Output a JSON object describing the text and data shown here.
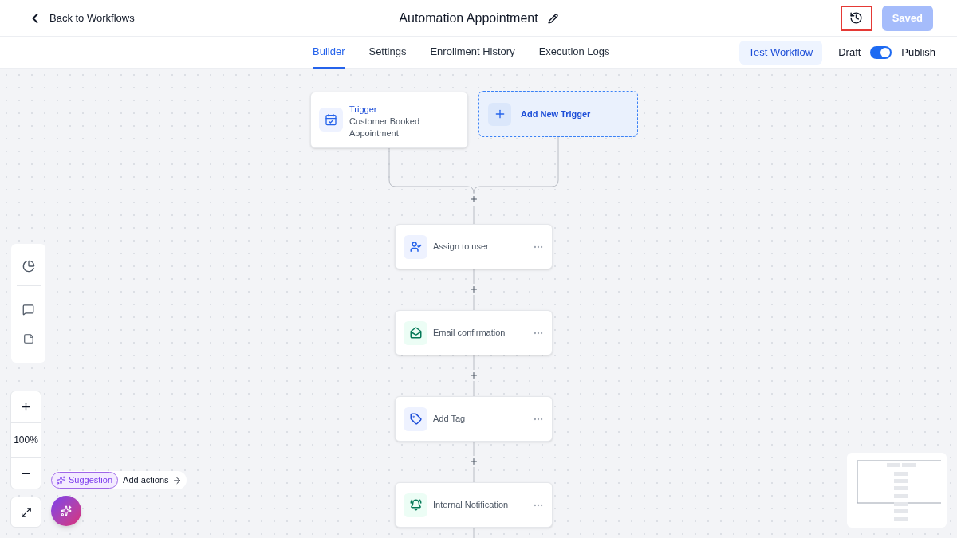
{
  "header": {
    "back_link": "Back to Workflows",
    "title": "Automation Appointment",
    "history_highlighted": true,
    "save_button": {
      "label": "Saved",
      "disabled": true
    }
  },
  "tabs": [
    {
      "label": "Builder",
      "selected": true
    },
    {
      "label": "Settings",
      "selected": false
    },
    {
      "label": "Enrollment History",
      "selected": false
    },
    {
      "label": "Execution Logs",
      "selected": false
    }
  ],
  "test_button": "Test Workflow",
  "publish_toggle": {
    "off_label": "Draft",
    "on_label": "Publish",
    "on": true
  },
  "trigger": {
    "heading": "Trigger",
    "name": "Customer Booked Appointment"
  },
  "add_trigger": "Add New Trigger",
  "actions": [
    {
      "kind": "user",
      "label": "Assign to user"
    },
    {
      "kind": "email",
      "label": "Email confirmation"
    },
    {
      "kind": "tag",
      "label": "Add Tag"
    },
    {
      "kind": "bell",
      "label": "Internal Notification"
    }
  ],
  "zoom": "100%",
  "suggestion": {
    "badge": "Suggestion",
    "action": "Add actions"
  }
}
